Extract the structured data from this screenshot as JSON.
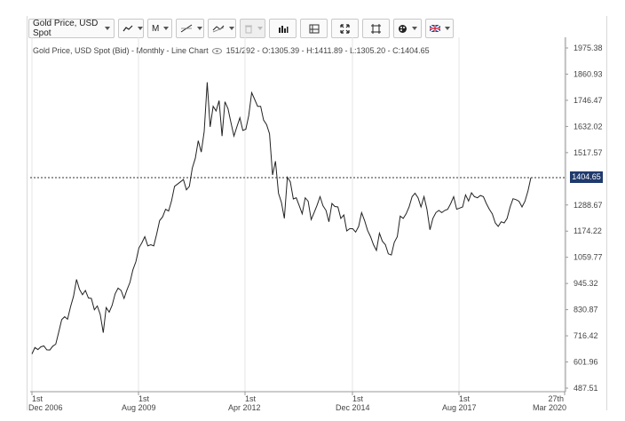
{
  "toolbar": {
    "instrument_label": "Gold Price, USD Spot",
    "chart_type_icon": "line-chart-icon",
    "interval_label": "M",
    "draw_tool_icon": "trendline-icon",
    "indicator_icon": "indicator-icon",
    "delete_icon": "trash-icon",
    "volume_icon": "volume-bars-icon",
    "layout_icon": "panel-layout-icon",
    "fit_icon": "expand-icon",
    "fullscreen_icon": "fullscreen-icon",
    "settings_icon": "paint-palette-icon",
    "locale_icon": "uk-flag-icon"
  },
  "subtitle": {
    "prefix": "Gold Price, USD Spot (Bid) - Monthly - Line Chart",
    "stats": "151/292 - O:1305.39 - H:1411.89 - L:1305.20 - C:1404.65"
  },
  "price_badge": "1404.65",
  "colors": {
    "line": "#222222",
    "badge": "#1f3a6d",
    "grid": "#e6e6e6"
  },
  "chart_data": {
    "type": "line",
    "y_ticks": [
      "1975.38",
      "1860.93",
      "1746.47",
      "1632.02",
      "1517.57",
      "1404.65",
      "1288.67",
      "1174.22",
      "1059.77",
      "945.32",
      "830.87",
      "716.42",
      "601.96",
      "487.51"
    ],
    "ylim": [
      487.51,
      1975.38
    ],
    "x_ticks": [
      {
        "day": "1st",
        "label": "Dec 2006"
      },
      {
        "day": "1st",
        "label": "Aug 2009"
      },
      {
        "day": "1st",
        "label": "Apr 2012"
      },
      {
        "day": "1st",
        "label": "Dec 2014"
      },
      {
        "day": "1st",
        "label": "Aug 2017"
      },
      {
        "day": "27th",
        "label": "Mar 2020"
      }
    ],
    "current_price": 1404.65,
    "series": [
      {
        "values": [
          637,
          665,
          656,
          668,
          672,
          655,
          654,
          671,
          680,
          732,
          787,
          800,
          789,
          844,
          889,
          963,
          920,
          896,
          915,
          882,
          880,
          830,
          847,
          810,
          730,
          840,
          820,
          850,
          900,
          925,
          915,
          880,
          917,
          950,
          1005,
          1041,
          1100,
          1123,
          1150,
          1110,
          1115,
          1110,
          1162,
          1220,
          1237,
          1270,
          1262,
          1306,
          1370,
          1380,
          1390,
          1400,
          1355,
          1370,
          1450,
          1493,
          1570,
          1520,
          1610,
          1825,
          1630,
          1720,
          1700,
          1745,
          1590,
          1740,
          1710,
          1650,
          1590,
          1630,
          1670,
          1615,
          1620,
          1680,
          1780,
          1750,
          1720,
          1720,
          1660,
          1640,
          1600,
          1420,
          1480,
          1340,
          1300,
          1230,
          1410,
          1390,
          1315,
          1320,
          1285,
          1250,
          1320,
          1305,
          1225,
          1255,
          1287,
          1325,
          1285,
          1265,
          1215,
          1295,
          1282,
          1280,
          1230,
          1245,
          1175,
          1185,
          1185,
          1170,
          1195,
          1255,
          1220,
          1178,
          1150,
          1115,
          1090,
          1165,
          1130,
          1115,
          1075,
          1070,
          1125,
          1150,
          1240,
          1230,
          1250,
          1280,
          1325,
          1340,
          1320,
          1280,
          1325,
          1270,
          1180,
          1230,
          1255,
          1265,
          1255,
          1265,
          1270,
          1295,
          1325,
          1270,
          1275,
          1280,
          1333,
          1306,
          1342,
          1325,
          1320,
          1330,
          1325,
          1295,
          1270,
          1250,
          1210,
          1195,
          1215,
          1210,
          1230,
          1280,
          1316,
          1312,
          1305,
          1280,
          1305,
          1350,
          1404.65
        ]
      }
    ]
  }
}
